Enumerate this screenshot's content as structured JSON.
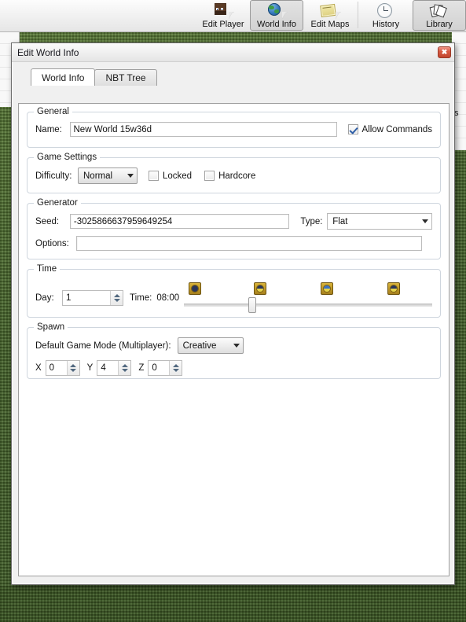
{
  "toolbar": {
    "items": [
      {
        "label": "Edit Player",
        "icon": "steve-head-icon",
        "selected": false
      },
      {
        "label": "World Info",
        "icon": "globe-icon",
        "selected": true
      },
      {
        "label": "Edit Maps",
        "icon": "map-icon",
        "selected": false
      },
      {
        "label": "History",
        "icon": "clock-icon",
        "selected": false
      },
      {
        "label": "Library",
        "icon": "books-icon",
        "selected": true
      }
    ]
  },
  "background": {
    "list_text": "s"
  },
  "dialog": {
    "title": "Edit World Info",
    "close_label": "✖",
    "tabs": [
      {
        "label": "World Info",
        "active": true
      },
      {
        "label": "NBT Tree",
        "active": false
      }
    ],
    "general": {
      "legend": "General",
      "name_label": "Name:",
      "name_value": "New World 15w36d",
      "allow_commands_label": "Allow Commands",
      "allow_commands_checked": true
    },
    "game_settings": {
      "legend": "Game Settings",
      "difficulty_label": "Difficulty:",
      "difficulty_value": "Normal",
      "locked_label": "Locked",
      "locked_checked": false,
      "hardcore_label": "Hardcore",
      "hardcore_checked": false
    },
    "generator": {
      "legend": "Generator",
      "seed_label": "Seed:",
      "seed_value": "-3025866637959649254",
      "type_label": "Type:",
      "type_value": "Flat",
      "options_label": "Options:",
      "options_value": ""
    },
    "time": {
      "legend": "Time",
      "day_label": "Day:",
      "day_value": "1",
      "time_label": "Time:",
      "time_value": "08:00",
      "slider_percent": 26,
      "clock_icons": [
        {
          "name": "clock-icon-night",
          "percent": 2,
          "top_color": "#2a3558",
          "bottom_color": "#2a3558"
        },
        {
          "name": "clock-icon-dawn",
          "percent": 28,
          "top_color": "#2a3558",
          "bottom_color": "#e3d24a"
        },
        {
          "name": "clock-icon-day",
          "percent": 55,
          "top_color": "#3a72c4",
          "bottom_color": "#e3d24a"
        },
        {
          "name": "clock-icon-dusk",
          "percent": 82,
          "top_color": "#2a3558",
          "bottom_color": "#e3d24a"
        }
      ]
    },
    "spawn": {
      "legend": "Spawn",
      "gamemode_label": "Default Game Mode (Multiplayer):",
      "gamemode_value": "Creative",
      "x_label": "X",
      "x_value": "0",
      "y_label": "Y",
      "y_value": "4",
      "z_label": "Z",
      "z_value": "0"
    }
  },
  "colors": {
    "accent": "#2f5fa8",
    "close_button": "#c2452e",
    "grass": "#4e7030"
  }
}
